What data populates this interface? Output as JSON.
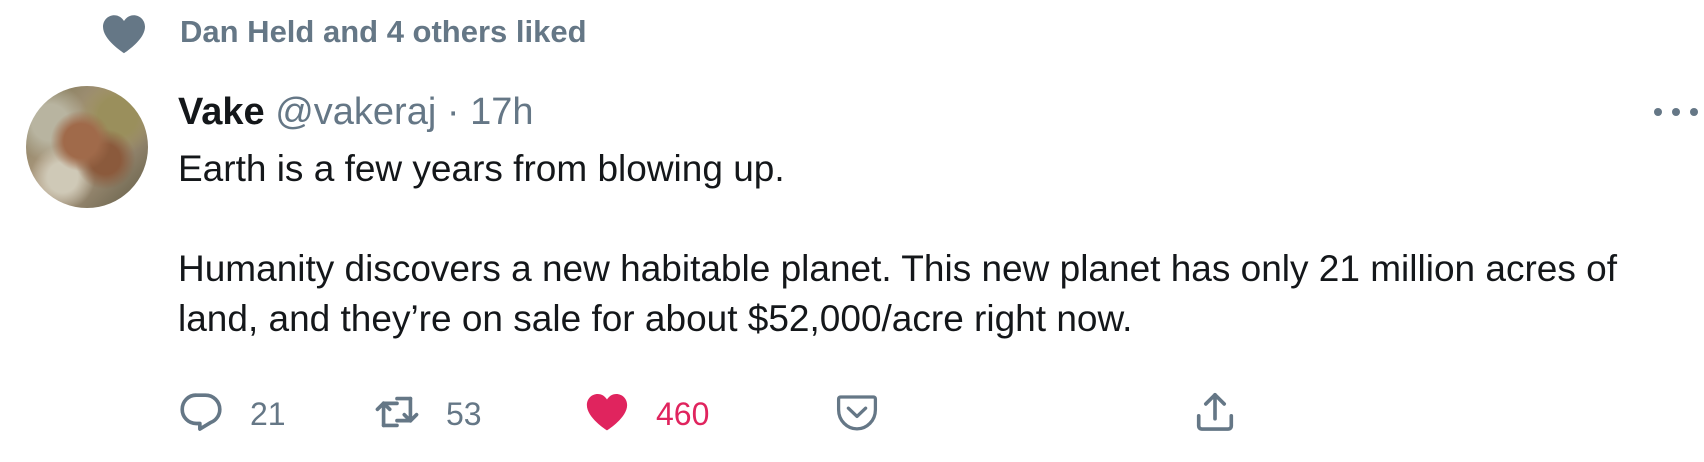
{
  "social_context": {
    "text": "Dan Held and 4 others liked",
    "icon": "heart-icon"
  },
  "tweet": {
    "author_name": "Vake",
    "handle": "@vakeraj",
    "separator": "·",
    "time": "17h",
    "paragraphs": [
      "Earth is a few years from blowing up.",
      "Humanity discovers a new habitable planet. This new planet has only 21 million acres of land, and they’re on sale for about $52,000/acre right now."
    ]
  },
  "actions": {
    "reply": {
      "icon": "reply-icon",
      "count": "21"
    },
    "retweet": {
      "icon": "retweet-icon",
      "count": "53"
    },
    "like": {
      "icon": "heart-icon",
      "count": "460",
      "liked": true
    },
    "save": {
      "icon": "pocket-save-icon"
    },
    "share": {
      "icon": "share-icon"
    }
  },
  "colors": {
    "text_primary": "#14171a",
    "text_secondary": "#657786",
    "like": "#e0245e",
    "icon_muted": "#657786"
  }
}
